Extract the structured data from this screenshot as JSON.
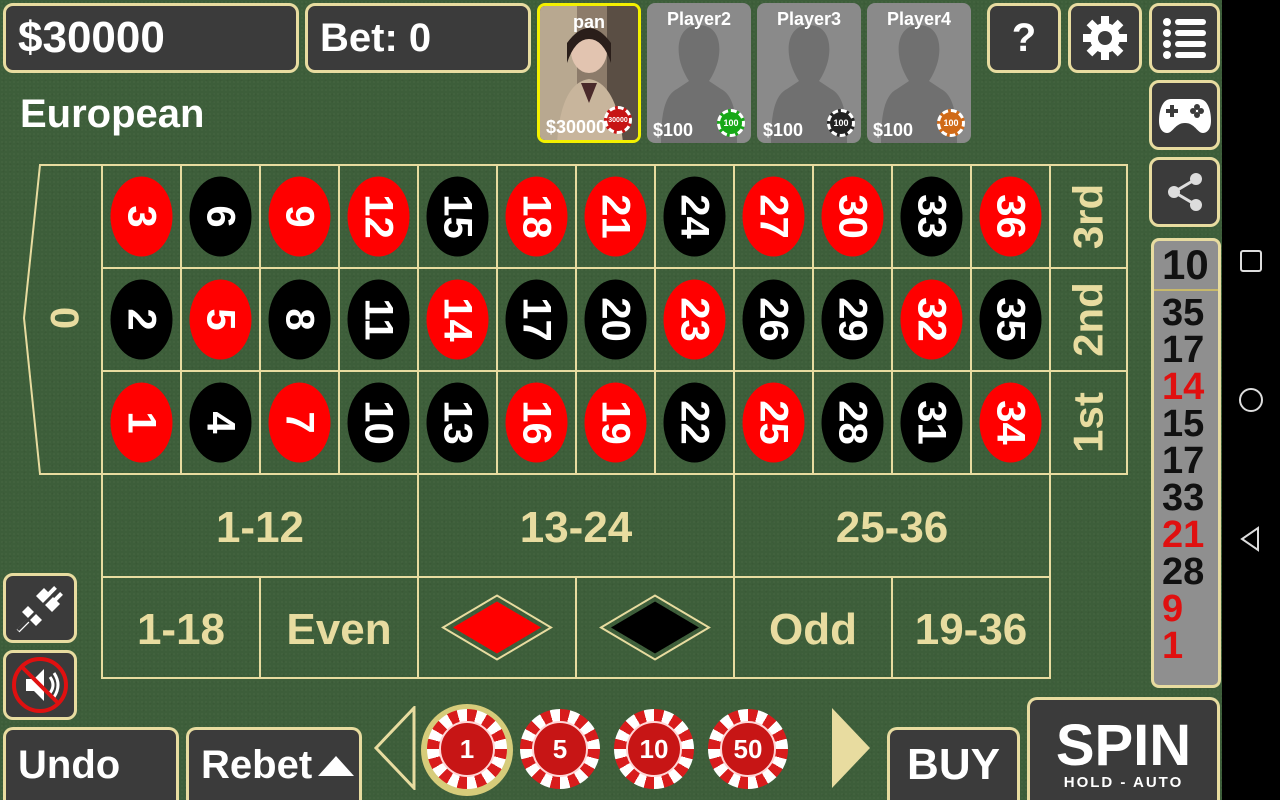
{
  "header": {
    "balance": "$30000",
    "bet": "Bet: 0",
    "game_type": "European"
  },
  "players": [
    {
      "name": "pan",
      "balance": "$30000",
      "chip_label": "30000",
      "chip_color": "#c71515",
      "selected": true
    },
    {
      "name": "Player2",
      "balance": "$100",
      "chip_label": "100",
      "chip_color": "#18a818",
      "selected": false
    },
    {
      "name": "Player3",
      "balance": "$100",
      "chip_label": "100",
      "chip_color": "#222222",
      "selected": false
    },
    {
      "name": "Player4",
      "balance": "$100",
      "chip_label": "100",
      "chip_color": "#d06a18",
      "selected": false
    }
  ],
  "top_buttons": {
    "help": "?",
    "settings_icon": "gear-icon",
    "menu_icon": "list-icon"
  },
  "side_buttons": {
    "gamepad_icon": "gamepad-icon",
    "share_icon": "share-icon"
  },
  "board": {
    "zero": "0",
    "rows": [
      [
        "3",
        "6",
        "9",
        "12",
        "15",
        "18",
        "21",
        "24",
        "27",
        "30",
        "33",
        "36"
      ],
      [
        "2",
        "5",
        "8",
        "11",
        "14",
        "17",
        "20",
        "23",
        "26",
        "29",
        "32",
        "35"
      ],
      [
        "1",
        "4",
        "7",
        "10",
        "13",
        "16",
        "19",
        "22",
        "25",
        "28",
        "31",
        "34"
      ]
    ],
    "red_numbers": [
      "1",
      "3",
      "5",
      "7",
      "9",
      "12",
      "14",
      "16",
      "18",
      "19",
      "21",
      "23",
      "25",
      "27",
      "30",
      "32",
      "34",
      "36"
    ],
    "columns": [
      "3rd",
      "2nd",
      "1st"
    ],
    "dozens": [
      "1-12",
      "13-24",
      "25-36"
    ],
    "outside": [
      "1-18",
      "Even",
      "red",
      "black",
      "Odd",
      "19-36"
    ]
  },
  "history": [
    {
      "value": "10",
      "color": "black"
    },
    {
      "value": "35",
      "color": "black"
    },
    {
      "value": "17",
      "color": "black"
    },
    {
      "value": "14",
      "color": "red"
    },
    {
      "value": "15",
      "color": "black"
    },
    {
      "value": "17",
      "color": "black"
    },
    {
      "value": "33",
      "color": "black"
    },
    {
      "value": "21",
      "color": "red"
    },
    {
      "value": "28",
      "color": "black"
    },
    {
      "value": "9",
      "color": "red"
    },
    {
      "value": "1",
      "color": "red"
    }
  ],
  "bottom": {
    "undo": "Undo",
    "rebet": "Rebet",
    "chips": [
      "1",
      "5",
      "10",
      "50"
    ],
    "buy": "BUY",
    "spin": "SPIN",
    "spin_sub": "HOLD - AUTO"
  },
  "colors": {
    "felt": "#3d5e3a",
    "line": "#e8dca0",
    "red": "#ff0000",
    "black": "#000000"
  }
}
